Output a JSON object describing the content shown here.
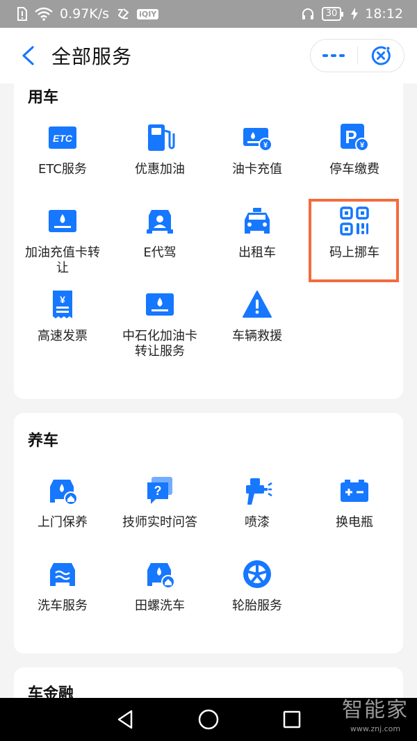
{
  "status_bar": {
    "speed": "0.97K/s",
    "battery": "30",
    "time": "18:12"
  },
  "header": {
    "title": "全部服务"
  },
  "sections": [
    {
      "title": "用车",
      "items": [
        {
          "label": "ETC服务",
          "icon": "etc-icon"
        },
        {
          "label": "优惠加油",
          "icon": "fuel-pump-icon"
        },
        {
          "label": "油卡充值",
          "icon": "fuel-card-recharge-icon"
        },
        {
          "label": "停车缴费",
          "icon": "parking-fee-icon"
        },
        {
          "label": "加油充值卡转让",
          "icon": "fuel-card-transfer-icon"
        },
        {
          "label": "E代驾",
          "icon": "designated-driver-icon"
        },
        {
          "label": "出租车",
          "icon": "taxi-icon"
        },
        {
          "label": "码上挪车",
          "icon": "qr-code-icon"
        },
        {
          "label": "高速发票",
          "icon": "invoice-icon"
        },
        {
          "label": "中石化加油卡转让服务",
          "icon": "sinopec-card-transfer-icon"
        },
        {
          "label": "车辆救援",
          "icon": "warning-icon"
        }
      ]
    },
    {
      "title": "养车",
      "items": [
        {
          "label": "上门保养",
          "icon": "car-maintenance-home-icon"
        },
        {
          "label": "技师实时问答",
          "icon": "question-chat-icon"
        },
        {
          "label": "喷漆",
          "icon": "spray-gun-icon"
        },
        {
          "label": "换电瓶",
          "icon": "battery-icon"
        },
        {
          "label": "洗车服务",
          "icon": "car-wash-icon"
        },
        {
          "label": "田螺洗车",
          "icon": "car-wash-home-icon"
        },
        {
          "label": "轮胎服务",
          "icon": "tire-icon"
        }
      ]
    },
    {
      "title": "车金融",
      "items": []
    }
  ],
  "watermark": {
    "main": "智能家",
    "sub": "www.znj.com"
  },
  "colors": {
    "accent": "#1677ff",
    "highlight": "#f36c3d",
    "background": "#f4f4f4"
  }
}
